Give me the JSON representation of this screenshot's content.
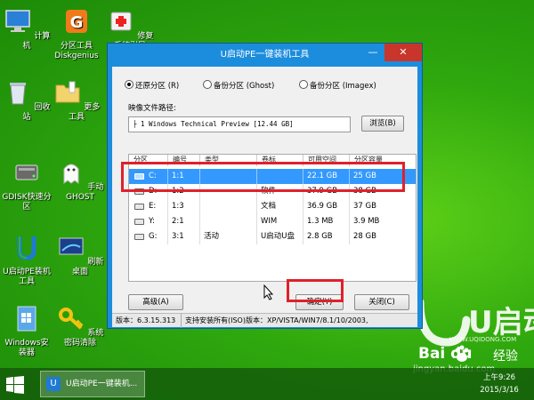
{
  "desktop": {
    "icons": [
      {
        "label": "计算机",
        "icon": "computer-icon"
      },
      {
        "label": "分区工具\nDiskgenius",
        "icon": "diskgenius-icon"
      },
      {
        "label": "修复系统引导",
        "icon": "repair-boot-icon"
      },
      {
        "label": "回收站",
        "icon": "recycle-bin-icon"
      },
      {
        "label": "更多工具",
        "icon": "folder-icon"
      },
      {
        "label": "GDISK快速分\n区",
        "icon": "gdisk-icon"
      },
      {
        "label": "手动GHOST",
        "icon": "ghost-icon"
      },
      {
        "label": "U启动PE装机\n工具",
        "icon": "uqidong-icon"
      },
      {
        "label": "刷新桌面",
        "icon": "refresh-desktop-icon"
      },
      {
        "label": "Windows安\n装器",
        "icon": "windows-installer-icon"
      },
      {
        "label": "系统密码清除",
        "icon": "key-icon"
      }
    ],
    "watermark_url": "WWW.UQIDONG.COM",
    "watermark_logo": "U启动"
  },
  "window": {
    "title": "U启动PE一键装机工具",
    "controls": {
      "minimize": "—",
      "close": "✕"
    },
    "radios": [
      {
        "label": "还原分区 (R)",
        "selected": true
      },
      {
        "label": "备份分区 (Ghost)",
        "selected": false
      },
      {
        "label": "备份分区 (Imagex)",
        "selected": false
      }
    ],
    "path_label": "映像文件路径:",
    "path_value": "├ 1 Windows Technical Preview [12.44 GB]",
    "browse_label": "浏览(B)",
    "table": {
      "headers": [
        "分区",
        "编号",
        "类型",
        "卷标",
        "可用空间",
        "分区容量"
      ],
      "rows": [
        [
          "C:",
          "1:1",
          "",
          "",
          "22.1 GB",
          "25 GB"
        ],
        [
          "D:",
          "1:2",
          "",
          "软件",
          "37.9 GB",
          "38 GB"
        ],
        [
          "E:",
          "1:3",
          "",
          "文档",
          "36.9 GB",
          "37 GB"
        ],
        [
          "Y:",
          "2:1",
          "",
          "WIM",
          "1.3 MB",
          "3.9 MB"
        ],
        [
          "G:",
          "3:1",
          "活动",
          "U启动U盘",
          "2.8 GB",
          "28 GB"
        ]
      ],
      "selected_row": 0
    },
    "buttons": {
      "advanced": "高级(A)",
      "confirm": "确定(Y)",
      "close": "关闭(C)"
    },
    "status": {
      "version": "版本：6.3.15.313",
      "support": "支持安装所有(ISO)版本：XP/VISTA/WIN7/8.1/10/2003,"
    }
  },
  "taskbar": {
    "item_label": "U启动PE一键装机...",
    "time": "上午9:26",
    "date": "2015/3/16"
  },
  "overlay": {
    "baidu_logo": "Bai  du",
    "baidu_jingyan": "经验",
    "baidu_url": "jingyan.baidu.com"
  },
  "colors": {
    "window_frame": "#1c8ddc",
    "selection": "#3399ff",
    "highlight_box": "#e0202a",
    "desktop": "#2fa80e"
  }
}
